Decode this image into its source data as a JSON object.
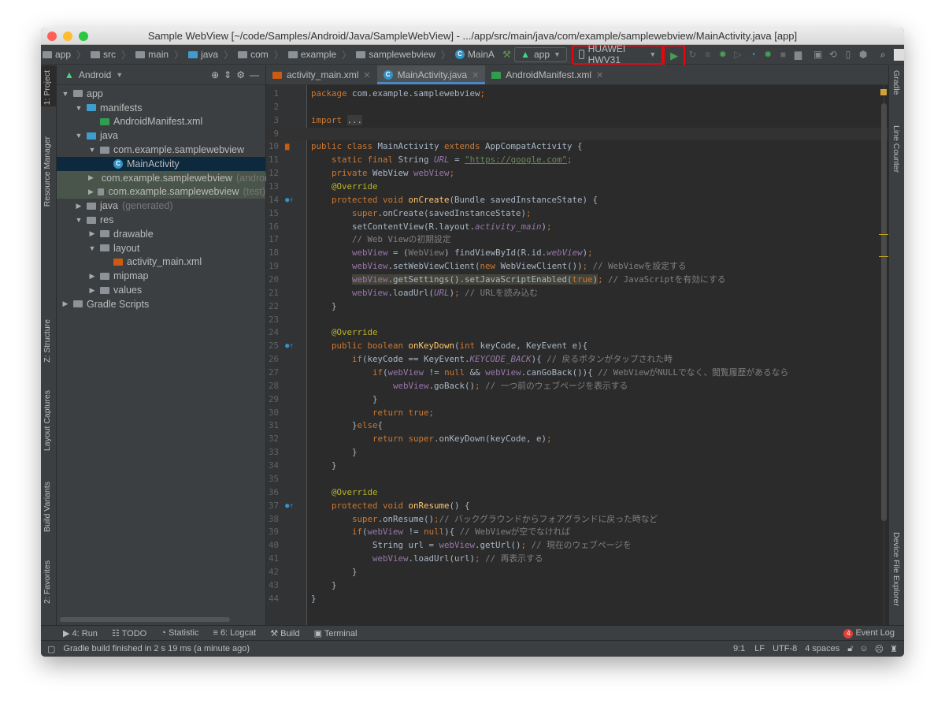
{
  "window": {
    "title": "Sample WebView [~/code/Samples/Android/Java/SampleWebView] - .../app/src/main/java/com/example/samplewebview/MainActivity.java [app]"
  },
  "breadcrumb": [
    "app",
    "src",
    "main",
    "java",
    "com",
    "example",
    "samplewebview",
    "MainA"
  ],
  "toolbar": {
    "config": "app",
    "device": "HUAWEI HWV31",
    "icons": [
      "hammer-icon",
      "run-icon",
      "apply-changes-icon",
      "apply-code-icon",
      "debug-icon",
      "attach-icon",
      "profile-icon",
      "attach-debugger-icon",
      "stop-icon",
      "project-structure-icon",
      "layout-inspector-icon",
      "sync-gradle-icon",
      "avd-manager-icon",
      "sdk-manager-icon",
      "search-icon",
      "user-icon"
    ]
  },
  "project": {
    "view": "Android",
    "tree": [
      {
        "label": "app",
        "depth": 0,
        "arrow": "down",
        "icon": "module"
      },
      {
        "label": "manifests",
        "depth": 1,
        "arrow": "down",
        "icon": "folder-blue"
      },
      {
        "label": "AndroidManifest.xml",
        "depth": 2,
        "arrow": "",
        "icon": "manifest"
      },
      {
        "label": "java",
        "depth": 1,
        "arrow": "down",
        "icon": "folder-blue"
      },
      {
        "label": "com.example.samplewebview",
        "depth": 2,
        "arrow": "down",
        "icon": "package"
      },
      {
        "label": "MainActivity",
        "depth": 3,
        "arrow": "",
        "icon": "class",
        "state": "selected"
      },
      {
        "label": "com.example.samplewebview",
        "suffix": "(androidTest)",
        "depth": 2,
        "arrow": "right",
        "icon": "package",
        "state": "test"
      },
      {
        "label": "com.example.samplewebview",
        "suffix": "(test)",
        "depth": 2,
        "arrow": "right",
        "icon": "package",
        "state": "test"
      },
      {
        "label": "java",
        "suffix": "(generated)",
        "depth": 1,
        "arrow": "right",
        "icon": "folder"
      },
      {
        "label": "res",
        "depth": 1,
        "arrow": "down",
        "icon": "folder"
      },
      {
        "label": "drawable",
        "depth": 2,
        "arrow": "right",
        "icon": "package"
      },
      {
        "label": "layout",
        "depth": 2,
        "arrow": "down",
        "icon": "package"
      },
      {
        "label": "activity_main.xml",
        "depth": 3,
        "arrow": "",
        "icon": "layout"
      },
      {
        "label": "mipmap",
        "depth": 2,
        "arrow": "right",
        "icon": "package"
      },
      {
        "label": "values",
        "depth": 2,
        "arrow": "right",
        "icon": "package"
      },
      {
        "label": "Gradle Scripts",
        "depth": 0,
        "arrow": "right",
        "icon": "gradle"
      }
    ]
  },
  "left_tools": [
    "1: Project",
    "Resource Manager",
    "Z: Structure",
    "Layout Captures",
    "Build Variants",
    "2: Favorites"
  ],
  "right_tools": [
    "Gradle",
    "Line Counter",
    "Device File Explorer"
  ],
  "tabs": [
    {
      "label": "activity_main.xml",
      "active": false
    },
    {
      "label": "MainActivity.java",
      "active": true
    },
    {
      "label": "AndroidManifest.xml",
      "active": false
    }
  ],
  "code": [
    {
      "n": "1",
      "t": [
        [
          "kw",
          "package "
        ],
        [
          "p",
          "com.example.samplewebview"
        ],
        [
          "kw",
          ";"
        ]
      ]
    },
    {
      "n": "2",
      "t": []
    },
    {
      "n": "3",
      "t": [
        [
          "kw",
          "import "
        ],
        [
          "foldx",
          "..."
        ]
      ]
    },
    {
      "n": "9",
      "t": [],
      "cur": true
    },
    {
      "n": "10",
      "t": [
        [
          "kw",
          "public class "
        ],
        [
          "p",
          "MainActivity "
        ],
        [
          "kw",
          "extends "
        ],
        [
          "p",
          "AppCompatActivity {"
        ]
      ]
    },
    {
      "n": "11",
      "t": [
        [
          "p",
          "    "
        ],
        [
          "kw",
          "static final "
        ],
        [
          "p",
          "String "
        ],
        [
          "fi",
          "URL"
        ],
        [
          "p",
          " = "
        ],
        [
          "str",
          "\"https://google.com\""
        ],
        [
          "kw",
          ";"
        ]
      ]
    },
    {
      "n": "12",
      "t": [
        [
          "p",
          "    "
        ],
        [
          "kw",
          "private "
        ],
        [
          "p",
          "WebView "
        ],
        [
          "fld",
          "webView"
        ],
        [
          "kw",
          ";"
        ]
      ]
    },
    {
      "n": "13",
      "t": [
        [
          "p",
          "    "
        ],
        [
          "ann",
          "@Override"
        ]
      ]
    },
    {
      "n": "14",
      "t": [
        [
          "p",
          "    "
        ],
        [
          "kw",
          "protected void "
        ],
        [
          "fn",
          "onCreate"
        ],
        [
          "p",
          "(Bundle savedInstanceState) {"
        ]
      ]
    },
    {
      "n": "15",
      "t": [
        [
          "p",
          "        "
        ],
        [
          "kw",
          "super"
        ],
        [
          "p",
          ".onCreate(savedInstanceState)"
        ],
        [
          "kw",
          ";"
        ]
      ]
    },
    {
      "n": "16",
      "t": [
        [
          "p",
          "        setContentView(R.layout."
        ],
        [
          "fi",
          "activity_main"
        ],
        [
          "p",
          ")"
        ],
        [
          "kw",
          ";"
        ]
      ]
    },
    {
      "n": "17",
      "t": [
        [
          "p",
          "        "
        ],
        [
          "cm",
          "// Web Viewの初期設定"
        ]
      ]
    },
    {
      "n": "18",
      "t": [
        [
          "p",
          "        "
        ],
        [
          "fld",
          "webView"
        ],
        [
          "p",
          " = ("
        ],
        [
          "cast",
          "WebView"
        ],
        [
          "p",
          ") findViewById(R.id."
        ],
        [
          "fi",
          "webView"
        ],
        [
          "p",
          ")"
        ],
        [
          "kw",
          ";"
        ]
      ]
    },
    {
      "n": "19",
      "t": [
        [
          "p",
          "        "
        ],
        [
          "fld",
          "webView"
        ],
        [
          "p",
          ".setWebViewClient("
        ],
        [
          "kw",
          "new "
        ],
        [
          "p",
          "WebViewClient())"
        ],
        [
          "kw",
          ";"
        ],
        [
          "cm",
          " // WebViewを設定する"
        ]
      ]
    },
    {
      "n": "20",
      "t": [
        [
          "p",
          "        "
        ],
        [
          "fld hl",
          "webView"
        ],
        [
          "p hl",
          ".getSettings().setJavaScriptEnabled("
        ],
        [
          "kw hl",
          "true"
        ],
        [
          "p hl",
          ")"
        ],
        [
          "kw",
          ";"
        ],
        [
          "cm",
          " // JavaScriptを有効にする"
        ]
      ]
    },
    {
      "n": "21",
      "t": [
        [
          "p",
          "        "
        ],
        [
          "fld",
          "webView"
        ],
        [
          "p",
          ".loadUrl("
        ],
        [
          "fi",
          "URL"
        ],
        [
          "p",
          ")"
        ],
        [
          "kw",
          ";"
        ],
        [
          "cm",
          " // URLを読み込む"
        ]
      ]
    },
    {
      "n": "22",
      "t": [
        [
          "p",
          "    }"
        ]
      ]
    },
    {
      "n": "23",
      "t": []
    },
    {
      "n": "24",
      "t": [
        [
          "p",
          "    "
        ],
        [
          "ann",
          "@Override"
        ]
      ]
    },
    {
      "n": "25",
      "t": [
        [
          "p",
          "    "
        ],
        [
          "kw",
          "public boolean "
        ],
        [
          "fn",
          "onKeyDown"
        ],
        [
          "p",
          "("
        ],
        [
          "kw",
          "int "
        ],
        [
          "p",
          "keyCode, KeyEvent e){"
        ]
      ]
    },
    {
      "n": "26",
      "t": [
        [
          "p",
          "        "
        ],
        [
          "kw",
          "if"
        ],
        [
          "p",
          "(keyCode == KeyEvent."
        ],
        [
          "fi",
          "KEYCODE_BACK"
        ],
        [
          "p",
          "){ "
        ],
        [
          "cm",
          "// 戻るボタンがタップされた時"
        ]
      ]
    },
    {
      "n": "27",
      "t": [
        [
          "p",
          "            "
        ],
        [
          "kw",
          "if"
        ],
        [
          "p",
          "("
        ],
        [
          "fld",
          "webView"
        ],
        [
          "p",
          " != "
        ],
        [
          "kw",
          "null "
        ],
        [
          "p",
          "&& "
        ],
        [
          "fld",
          "webView"
        ],
        [
          "p",
          ".canGoBack()){ "
        ],
        [
          "cm",
          "// WebViewがNULLでなく、閲覧履歴があるなら"
        ]
      ]
    },
    {
      "n": "28",
      "t": [
        [
          "p",
          "                "
        ],
        [
          "fld",
          "webView"
        ],
        [
          "p",
          ".goBack()"
        ],
        [
          "kw",
          ";"
        ],
        [
          "cm",
          " // 一つ前のウェブページを表示する"
        ]
      ]
    },
    {
      "n": "29",
      "t": [
        [
          "p",
          "            }"
        ]
      ]
    },
    {
      "n": "30",
      "t": [
        [
          "p",
          "            "
        ],
        [
          "kw",
          "return true;"
        ]
      ]
    },
    {
      "n": "31",
      "t": [
        [
          "p",
          "        }"
        ],
        [
          "kw",
          "else"
        ],
        [
          "p",
          "{"
        ]
      ]
    },
    {
      "n": "32",
      "t": [
        [
          "p",
          "            "
        ],
        [
          "kw",
          "return super"
        ],
        [
          "p",
          ".onKeyDown(keyCode, e)"
        ],
        [
          "kw",
          ";"
        ]
      ]
    },
    {
      "n": "33",
      "t": [
        [
          "p",
          "        }"
        ]
      ]
    },
    {
      "n": "34",
      "t": [
        [
          "p",
          "    }"
        ]
      ]
    },
    {
      "n": "35",
      "t": []
    },
    {
      "n": "36",
      "t": [
        [
          "p",
          "    "
        ],
        [
          "ann",
          "@Override"
        ]
      ]
    },
    {
      "n": "37",
      "t": [
        [
          "p",
          "    "
        ],
        [
          "kw",
          "protected void "
        ],
        [
          "fn",
          "onResume"
        ],
        [
          "p",
          "() {"
        ]
      ]
    },
    {
      "n": "38",
      "t": [
        [
          "p",
          "        "
        ],
        [
          "kw",
          "super"
        ],
        [
          "p",
          ".onResume()"
        ],
        [
          "kw",
          ";"
        ],
        [
          "cm",
          "// バックグラウンドからフォアグランドに戻った時など"
        ]
      ]
    },
    {
      "n": "39",
      "t": [
        [
          "p",
          "        "
        ],
        [
          "kw",
          "if"
        ],
        [
          "p",
          "("
        ],
        [
          "fld",
          "webView"
        ],
        [
          "p",
          " != "
        ],
        [
          "kw",
          "null"
        ],
        [
          "p",
          "){ "
        ],
        [
          "cm",
          "// WebViewが空でなければ"
        ]
      ]
    },
    {
      "n": "40",
      "t": [
        [
          "p",
          "            String url = "
        ],
        [
          "fld",
          "webView"
        ],
        [
          "p",
          ".getUrl()"
        ],
        [
          "kw",
          ";"
        ],
        [
          "cm",
          " // 現在のウェブページを"
        ]
      ]
    },
    {
      "n": "41",
      "t": [
        [
          "p",
          "            "
        ],
        [
          "fld",
          "webView"
        ],
        [
          "p",
          ".loadUrl(url)"
        ],
        [
          "kw",
          ";"
        ],
        [
          "cm",
          " // 再表示する"
        ]
      ]
    },
    {
      "n": "42",
      "t": [
        [
          "p",
          "        }"
        ]
      ]
    },
    {
      "n": "43",
      "t": [
        [
          "p",
          "    }"
        ]
      ]
    },
    {
      "n": "44",
      "t": [
        [
          "p",
          "}"
        ]
      ]
    }
  ],
  "bottom_tools": [
    "4: Run",
    "TODO",
    "Statistic",
    "6: Logcat",
    "Build",
    "Terminal"
  ],
  "event_log": {
    "label": "Event Log",
    "count": "4"
  },
  "status": {
    "message": "Gradle build finished in 2 s 19 ms (a minute ago)",
    "position": "9:1",
    "line_sep": "LF",
    "encoding": "UTF-8",
    "indent": "4 spaces"
  },
  "colors": {
    "highlight_box": "#e8050b",
    "run_green": "#499c54",
    "selection": "#0d293e"
  }
}
